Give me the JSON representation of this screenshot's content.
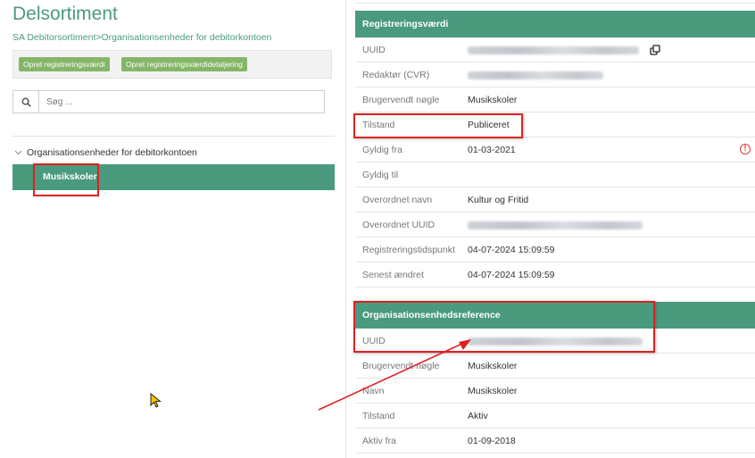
{
  "page": {
    "title": "Delsortiment",
    "breadcrumb": [
      "SA Debitorsortiment",
      ">",
      "Organisationsenheder for debitorkontoen"
    ]
  },
  "actions": {
    "create_value": "Opret registreringsværdi",
    "create_value_detail": "Opret registreringsværdidetaljering"
  },
  "search": {
    "placeholder": "Søg ..."
  },
  "tree": {
    "root": "Organisationsenheder for debitorkontoen",
    "child": "Musikskoler"
  },
  "registration": {
    "header": "Registreringsværdi",
    "rows": [
      {
        "label": "UUID",
        "value": ""
      },
      {
        "label": "Redaktør (CVR)",
        "value": ""
      },
      {
        "label": "Brugervendt nøgle",
        "value": "Musikskoler"
      },
      {
        "label": "Tilstand",
        "value": "Publiceret"
      },
      {
        "label": "Gyldig fra",
        "value": "01-03-2021"
      },
      {
        "label": "Gyldig til",
        "value": ""
      },
      {
        "label": "Overordnet navn",
        "value": "Kultur og Fritid"
      },
      {
        "label": "Overordnet UUID",
        "value": ""
      },
      {
        "label": "Registreringstidspunkt",
        "value": "04-07-2024 15:09:59"
      },
      {
        "label": "Senest ændret",
        "value": "04-07-2024 15:09:59"
      }
    ]
  },
  "org_ref": {
    "header": "Organisationsenhedsreference",
    "rows": [
      {
        "label": "UUID",
        "value": ""
      },
      {
        "label": "Brugervendt nøgle",
        "value": "Musikskoler"
      },
      {
        "label": "Navn",
        "value": "Musikskoler"
      },
      {
        "label": "Tilstand",
        "value": "Aktiv"
      },
      {
        "label": "Aktiv fra",
        "value": "01-09-2018"
      }
    ]
  },
  "colors": {
    "accent": "#4a9a7e",
    "button_green": "#84b667",
    "annotation_red": "#e02020",
    "warning": "#e53935"
  },
  "icons": [
    "search-icon",
    "chevron-down-icon",
    "copy-icon",
    "warning-icon",
    "mouse-cursor-icon",
    "annotation-arrow"
  ]
}
